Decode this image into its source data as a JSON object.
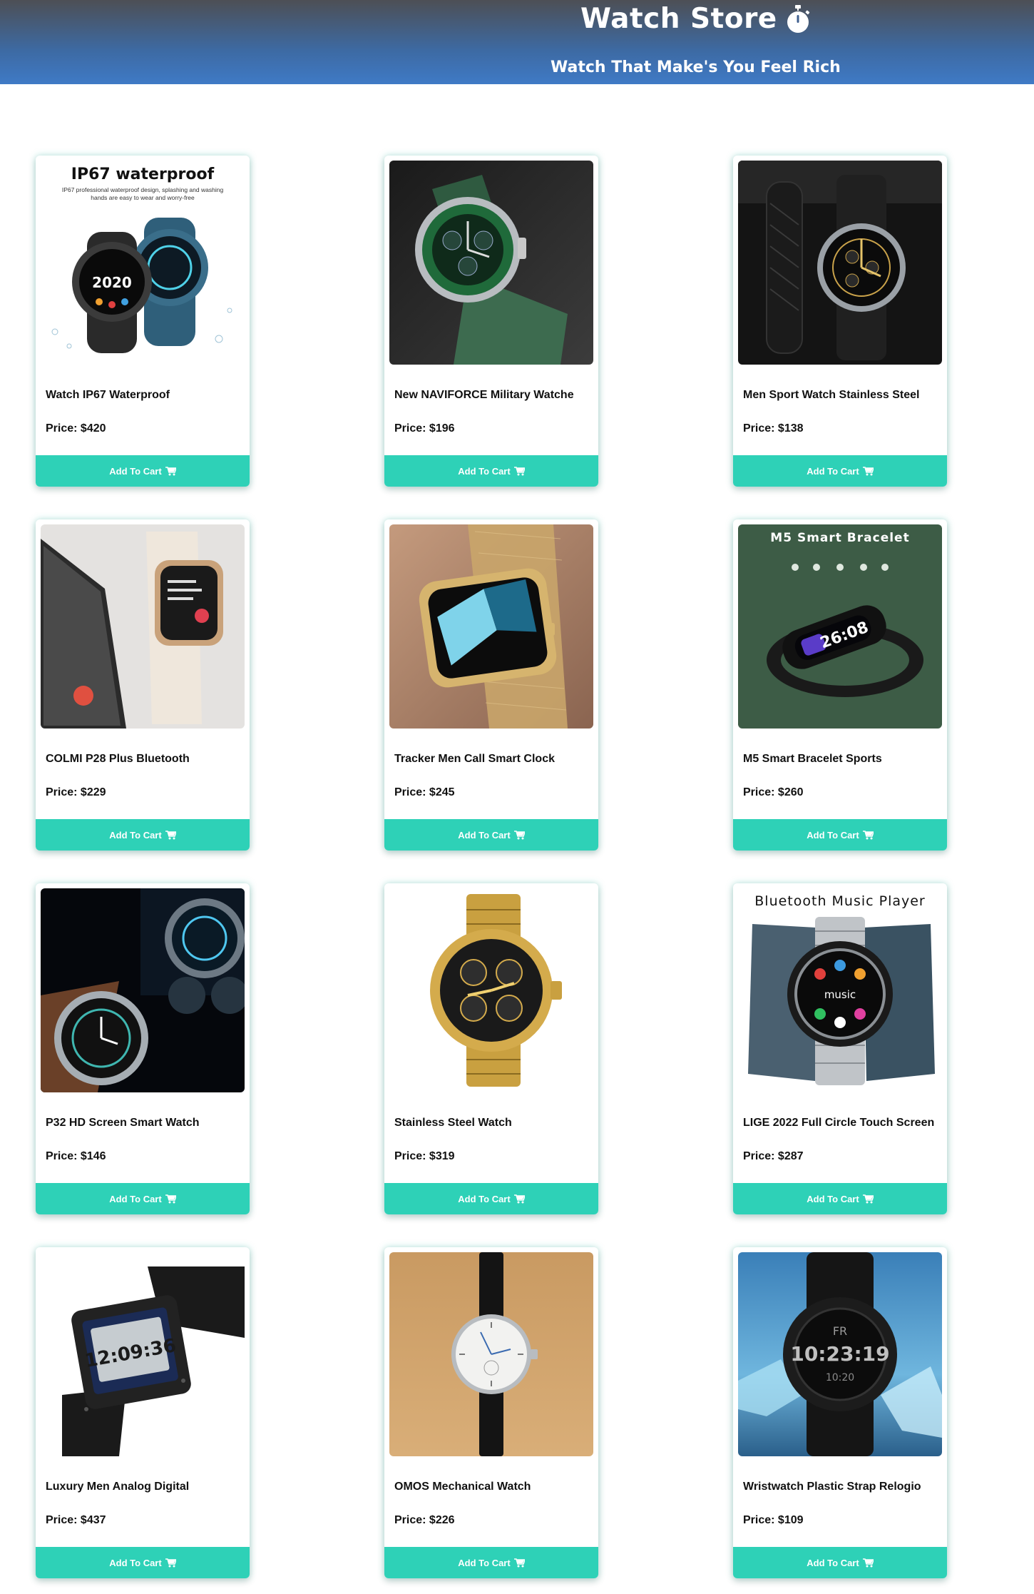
{
  "header": {
    "title": "Watch Store",
    "tagline": "Watch That Make's You Feel Rich"
  },
  "cart_button_label": "Add To Cart",
  "products": [
    {
      "name": "Watch IP67 Waterproof",
      "price": "Price: $420",
      "image_caption": "IP67 waterproof",
      "image_subcaption": "IP67 professional waterproof design, splashing and washing hands are easy to wear and worry-free",
      "display_text": "2020"
    },
    {
      "name": "New NAVIFORCE Military Watche",
      "price": "Price: $196"
    },
    {
      "name": "Men Sport Watch Stainless Steel",
      "price": "Price: $138"
    },
    {
      "name": "COLMI P28 Plus Bluetooth",
      "price": "Price: $229"
    },
    {
      "name": "Tracker Men Call Smart Clock",
      "price": "Price: $245"
    },
    {
      "name": "M5 Smart Bracelet Sports",
      "price": "Price: $260",
      "image_caption": "M5 Smart Bracelet"
    },
    {
      "name": "P32 HD Screen Smart Watch",
      "price": "Price: $146"
    },
    {
      "name": "Stainless Steel Watch",
      "price": "Price: $319"
    },
    {
      "name": "LIGE 2022 Full Circle Touch Screen",
      "price": "Price: $287",
      "image_caption": "Bluetooth Music Player",
      "display_text": "music"
    },
    {
      "name": "Luxury Men Analog Digital",
      "price": "Price: $437",
      "display_text": "12:09:36"
    },
    {
      "name": "OMOS Mechanical Watch",
      "price": "Price: $226"
    },
    {
      "name": "Wristwatch Plastic Strap Relogio",
      "price": "Price: $109",
      "display_text": "10:23:19"
    }
  ],
  "colors": {
    "header_top": "#4d4f55",
    "header_bottom": "#3f7ac6",
    "button": "#2ed1b7",
    "text": "#111111"
  },
  "icons": [
    "stopwatch-icon",
    "cart-icon"
  ]
}
